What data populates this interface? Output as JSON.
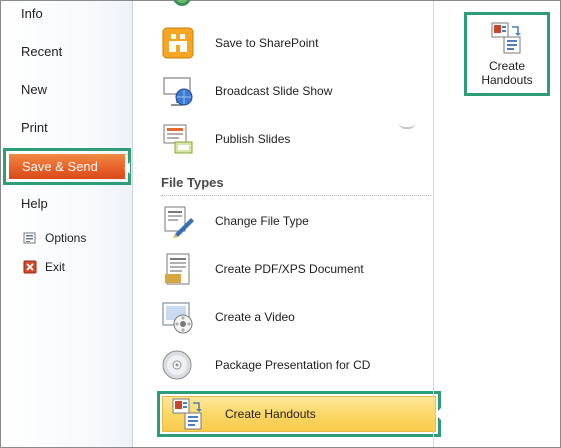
{
  "nav": {
    "items": [
      {
        "label": "Info"
      },
      {
        "label": "Recent"
      },
      {
        "label": "New"
      },
      {
        "label": "Print"
      },
      {
        "label": "Save & Send"
      },
      {
        "label": "Help"
      },
      {
        "label": "Options",
        "icon": "options-icon"
      },
      {
        "label": "Exit",
        "icon": "exit-icon"
      }
    ],
    "active": "Save & Send"
  },
  "send": {
    "items": [
      {
        "label": "Save to SharePoint",
        "icon": "sharepoint-icon"
      },
      {
        "label": "Broadcast Slide Show",
        "icon": "broadcast-icon"
      },
      {
        "label": "Publish Slides",
        "icon": "publish-slides-icon"
      }
    ]
  },
  "file_types": {
    "heading": "File Types",
    "items": [
      {
        "label": "Change File Type",
        "icon": "change-file-type-icon"
      },
      {
        "label": "Create PDF/XPS Document",
        "icon": "pdf-xps-icon"
      },
      {
        "label": "Create a Video",
        "icon": "video-icon"
      },
      {
        "label": "Package Presentation for CD",
        "icon": "cd-icon"
      },
      {
        "label": "Create Handouts",
        "icon": "handouts-icon",
        "selected": true
      }
    ]
  },
  "right_panel": {
    "button_line1": "Create",
    "button_line2": "Handouts",
    "icon": "handouts-icon"
  },
  "colors": {
    "highlight_border": "#2e9c77",
    "active_nav": "#e8622a",
    "selected_row": "#fbd868"
  }
}
